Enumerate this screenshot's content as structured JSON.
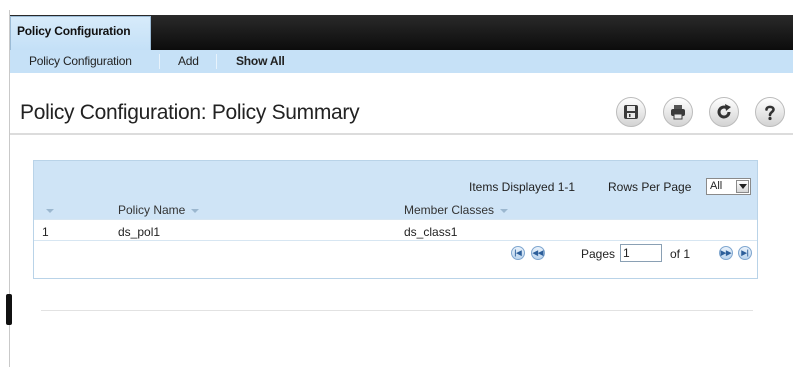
{
  "main_tab": {
    "label": "Policy Configuration"
  },
  "subnav": {
    "items": [
      {
        "label": "Policy Configuration",
        "active": false
      },
      {
        "label": "Add",
        "active": false
      },
      {
        "label": "Show All",
        "active": true
      }
    ]
  },
  "page": {
    "title": "Policy Configuration: Policy Summary"
  },
  "toolbar": {
    "icons": [
      "save-icon",
      "print-icon",
      "refresh-icon",
      "help-icon"
    ]
  },
  "table": {
    "items_displayed": "Items Displayed 1-1",
    "rows_per_page_label": "Rows Per Page",
    "rows_per_page_value": "All",
    "columns": [
      "Policy Name",
      "Member Classes"
    ],
    "rows": [
      {
        "index": "1",
        "policy_name": "ds_pol1",
        "member_classes": "ds_class1"
      }
    ],
    "pager": {
      "pages_label": "Pages",
      "current_page": "1",
      "of_label": "of 1"
    }
  },
  "colors": {
    "topbar": "#111111",
    "tab_background": "#c6e1f7",
    "panel_header": "#cfe4f6",
    "panel_border": "#b9d3e8"
  }
}
